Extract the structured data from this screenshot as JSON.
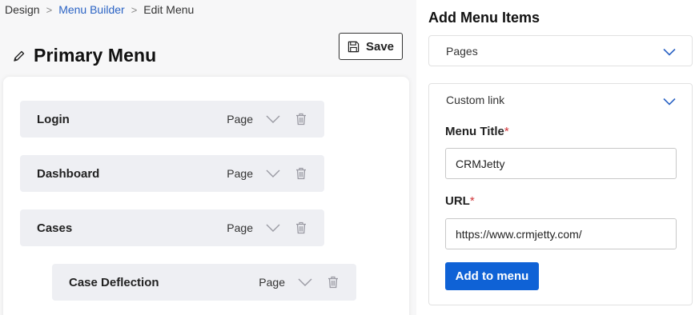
{
  "breadcrumb": {
    "items": [
      "Design",
      "Menu Builder",
      "Edit Menu"
    ],
    "separator": ">"
  },
  "menu": {
    "title": "Primary Menu",
    "save_label": "Save",
    "items": [
      {
        "label": "Login",
        "type": "Page",
        "level": 0
      },
      {
        "label": "Dashboard",
        "type": "Page",
        "level": 0
      },
      {
        "label": "Cases",
        "type": "Page",
        "level": 0
      },
      {
        "label": "Case Deflection",
        "type": "Page",
        "level": 1
      }
    ]
  },
  "add_panel": {
    "title": "Add Menu Items",
    "pages_label": "Pages",
    "custom_link_label": "Custom link",
    "menu_title_label": "Menu Title",
    "menu_title_value": "CRMJetty",
    "url_label": "URL",
    "url_value": "https://www.crmjetty.com/",
    "required_marker": "*",
    "add_button_label": "Add to menu"
  },
  "colors": {
    "link": "#2b63c4",
    "primary_button": "#0f62d6",
    "required": "#d13438",
    "chevron": "#2b63c4",
    "item_bg": "#eeeff3",
    "annotation_arrow": "#e53935"
  },
  "icons": {
    "edit": "pencil-icon",
    "save": "floppy-disk-icon",
    "expand": "chevron-down-icon",
    "delete": "trash-icon"
  }
}
